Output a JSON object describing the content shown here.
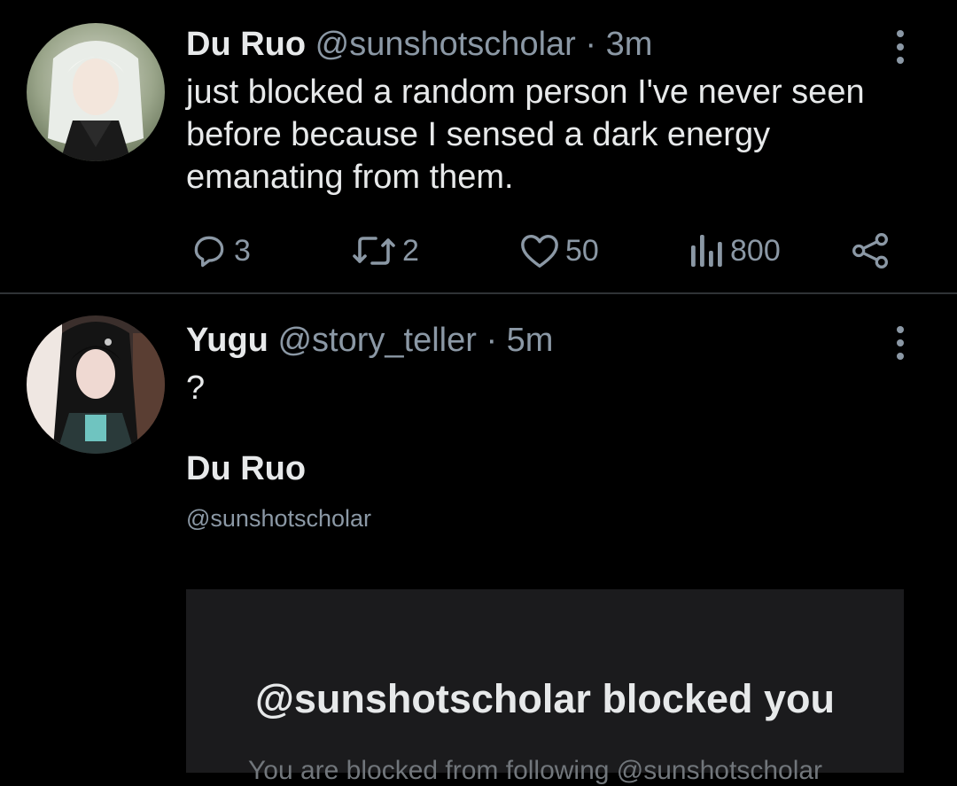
{
  "tweets": [
    {
      "name": "Du Ruo",
      "handle": "@sunshotscholar",
      "dot": "·",
      "time": "3m",
      "text": "just blocked a random person I've never seen before because I sensed a dark energy emanating from them.",
      "actions": {
        "replies": "3",
        "retweets": "2",
        "likes": "50",
        "views": "800"
      }
    },
    {
      "name": "Yugu",
      "handle": "@story_teller",
      "dot": "·",
      "time": "5m",
      "text": "?",
      "quoted": {
        "name": "Du Ruo",
        "handle": "@sunshotscholar",
        "panel_title": "@sunshotscholar blocked you",
        "panel_text": "You are blocked from following @sunshotscholar"
      }
    }
  ],
  "colors": {
    "background": "#000000",
    "text": "#e7e9ea",
    "muted": "#8b98a5",
    "divider": "#2f3336",
    "panel": "#1b1b1d"
  },
  "icons": {
    "reply": "reply-icon",
    "retweet": "retweet-icon",
    "like": "heart-icon",
    "views": "views-icon",
    "share": "share-icon",
    "more": "more-icon"
  }
}
